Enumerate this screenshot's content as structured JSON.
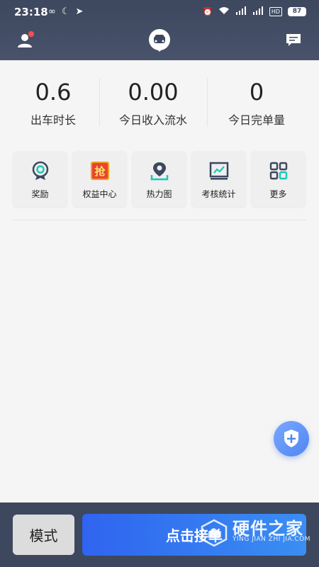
{
  "status_bar": {
    "time": "23:18",
    "battery": "87",
    "hd_label": "HD"
  },
  "stats": [
    {
      "value": "0.6",
      "label": "出车时长"
    },
    {
      "value": "0.00",
      "label": "今日收入流水"
    },
    {
      "value": "0",
      "label": "今日完单量"
    }
  ],
  "tools": [
    {
      "label": "奖励",
      "icon": "award-icon"
    },
    {
      "label": "权益中心",
      "icon": "grab-badge-icon",
      "icon_text": "抢"
    },
    {
      "label": "热力图",
      "icon": "map-pin-icon"
    },
    {
      "label": "考核统计",
      "icon": "chart-board-icon"
    },
    {
      "label": "更多",
      "icon": "grid-more-icon"
    }
  ],
  "bottom": {
    "mode_label": "模式",
    "accept_label": "点击接单"
  },
  "watermark": {
    "main": "硬件之家",
    "sub": "YING JIAN ZHI JIA.COM"
  },
  "colors": {
    "header": "#3d475e",
    "accent": "#2f64f0",
    "notify": "#ff4d4f",
    "teal": "#1fc7b5"
  }
}
